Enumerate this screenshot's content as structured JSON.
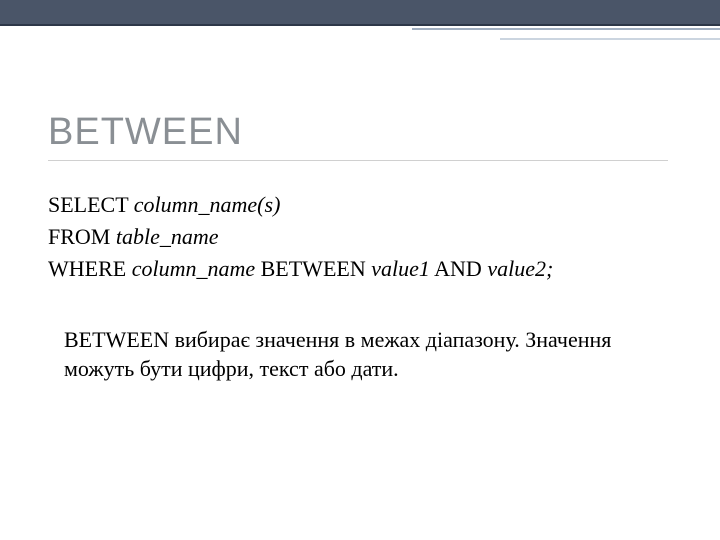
{
  "title": "BETWEEN",
  "sql": {
    "line1_kw": "SELECT ",
    "line1_it": "column_name(s)",
    "line2_kw": "FROM ",
    "line2_it": "table_name",
    "line3_kw1": "WHERE ",
    "line3_it1": "column_name",
    "line3_kw2": " BETWEEN ",
    "line3_it2": "value1",
    "line3_kw3": " AND ",
    "line3_it3": "value2;"
  },
  "description": "BETWEEN вибирає значення в межах діапазону. Значення можуть бути цифри, текст або дати."
}
